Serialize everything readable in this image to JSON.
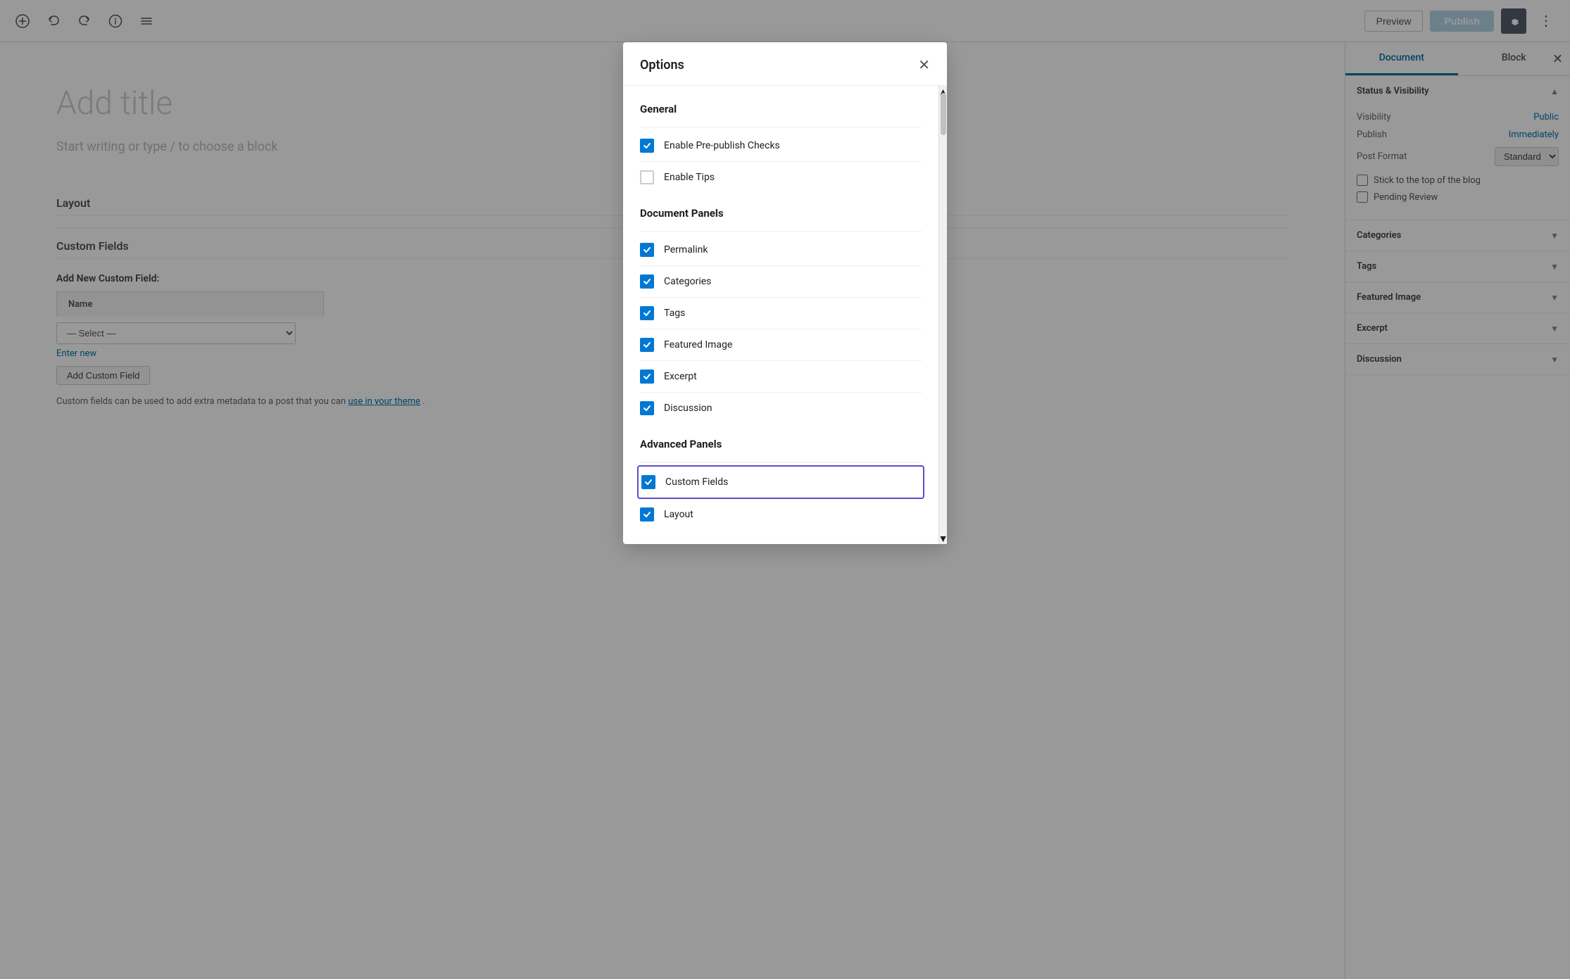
{
  "toolbar": {
    "preview_label": "Preview",
    "publish_label": "Publish",
    "dots_icon": "⋮"
  },
  "editor": {
    "title_placeholder": "Add title",
    "body_placeholder": "Start writing or type / to choose a block",
    "layout_label": "Layout",
    "custom_fields_label": "Custom Fields",
    "add_new_field_label": "Add New Custom Field:",
    "name_column": "Name",
    "select_placeholder": "— Select —",
    "enter_new_label": "Enter new",
    "add_button_label": "Add Custom Field",
    "help_text": "Custom fields can be used to add extra metadata to a post that you can",
    "help_link_text": "use in your theme",
    "help_text_end": "."
  },
  "sidebar": {
    "tab_document": "Document",
    "tab_block": "Block",
    "sections": [
      {
        "id": "status-visibility",
        "title": "Status & Visibility",
        "open": true,
        "rows": [
          {
            "label": "Visibility",
            "value": "Public",
            "link": true
          },
          {
            "label": "Publish",
            "value": "Immediately",
            "link": true
          }
        ],
        "post_format_label": "Post Format",
        "post_format_value": "Standard",
        "checkboxes": [
          {
            "label": "Stick to the top of the blog",
            "checked": false
          },
          {
            "label": "Pending Review",
            "checked": false
          }
        ]
      },
      {
        "id": "categories",
        "title": "Categories",
        "open": false
      },
      {
        "id": "tags",
        "title": "Tags",
        "open": false
      },
      {
        "id": "featured-image",
        "title": "Featured Image",
        "open": false
      },
      {
        "id": "excerpt",
        "title": "Excerpt",
        "open": false
      },
      {
        "id": "discussion",
        "title": "Discussion",
        "open": false
      }
    ]
  },
  "modal": {
    "title": "Options",
    "sections": [
      {
        "id": "general",
        "title": "General",
        "items": [
          {
            "id": "pre-publish",
            "label": "Enable Pre-publish Checks",
            "checked": true
          },
          {
            "id": "tips",
            "label": "Enable Tips",
            "checked": false
          }
        ]
      },
      {
        "id": "document-panels",
        "title": "Document Panels",
        "items": [
          {
            "id": "permalink",
            "label": "Permalink",
            "checked": true
          },
          {
            "id": "categories",
            "label": "Categories",
            "checked": true
          },
          {
            "id": "tags",
            "label": "Tags",
            "checked": true
          },
          {
            "id": "featured-image",
            "label": "Featured Image",
            "checked": true
          },
          {
            "id": "excerpt",
            "label": "Excerpt",
            "checked": true
          },
          {
            "id": "discussion",
            "label": "Discussion",
            "checked": true
          }
        ]
      },
      {
        "id": "advanced-panels",
        "title": "Advanced Panels",
        "items": [
          {
            "id": "custom-fields",
            "label": "Custom Fields",
            "checked": true,
            "highlighted": true
          },
          {
            "id": "layout",
            "label": "Layout",
            "checked": true
          }
        ]
      }
    ]
  },
  "icons": {
    "plus": "+",
    "undo": "↩",
    "redo": "↪",
    "info": "ℹ",
    "menu": "☰",
    "close": "✕",
    "gear": "⚙",
    "check": "✓",
    "chevron_down": "›",
    "chevron_up": "‹",
    "scroll_up": "▲",
    "scroll_down": "▼"
  },
  "colors": {
    "accent": "#0073aa",
    "publish_bg": "#b5d6e8",
    "checkbox_checked": "#0078d4",
    "highlighted_border": "#5b4fcf",
    "tab_active": "#0073aa"
  }
}
